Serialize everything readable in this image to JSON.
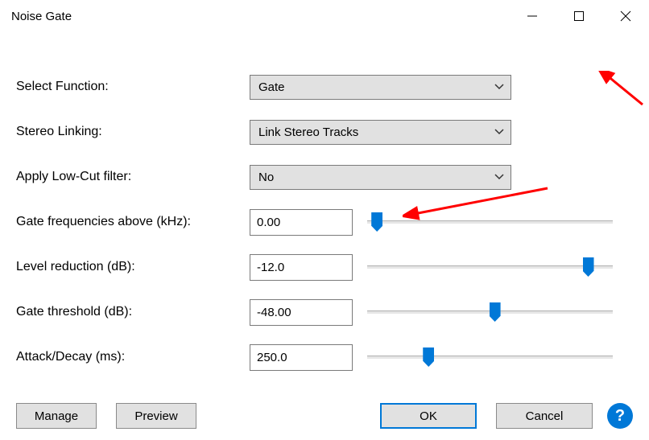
{
  "title": "Noise Gate",
  "fields": {
    "selectFunction": {
      "label": "Select Function:",
      "value": "Gate"
    },
    "stereoLinking": {
      "label": "Stereo Linking:",
      "value": "Link Stereo Tracks"
    },
    "lowCut": {
      "label": "Apply Low-Cut filter:",
      "value": "No"
    },
    "gateFreq": {
      "label": "Gate frequencies above (kHz):",
      "value": "0.00",
      "sliderPct": 4
    },
    "levelReduction": {
      "label": "Level reduction (dB):",
      "value": "-12.0",
      "sliderPct": 90
    },
    "gateThreshold": {
      "label": "Gate threshold (dB):",
      "value": "-48.00",
      "sliderPct": 52
    },
    "attackDecay": {
      "label": "Attack/Decay (ms):",
      "value": "250.0",
      "sliderPct": 25
    }
  },
  "buttons": {
    "manage": "Manage",
    "preview": "Preview",
    "ok": "OK",
    "cancel": "Cancel",
    "help": "?"
  },
  "annotations": {
    "color": "#ff0000"
  }
}
